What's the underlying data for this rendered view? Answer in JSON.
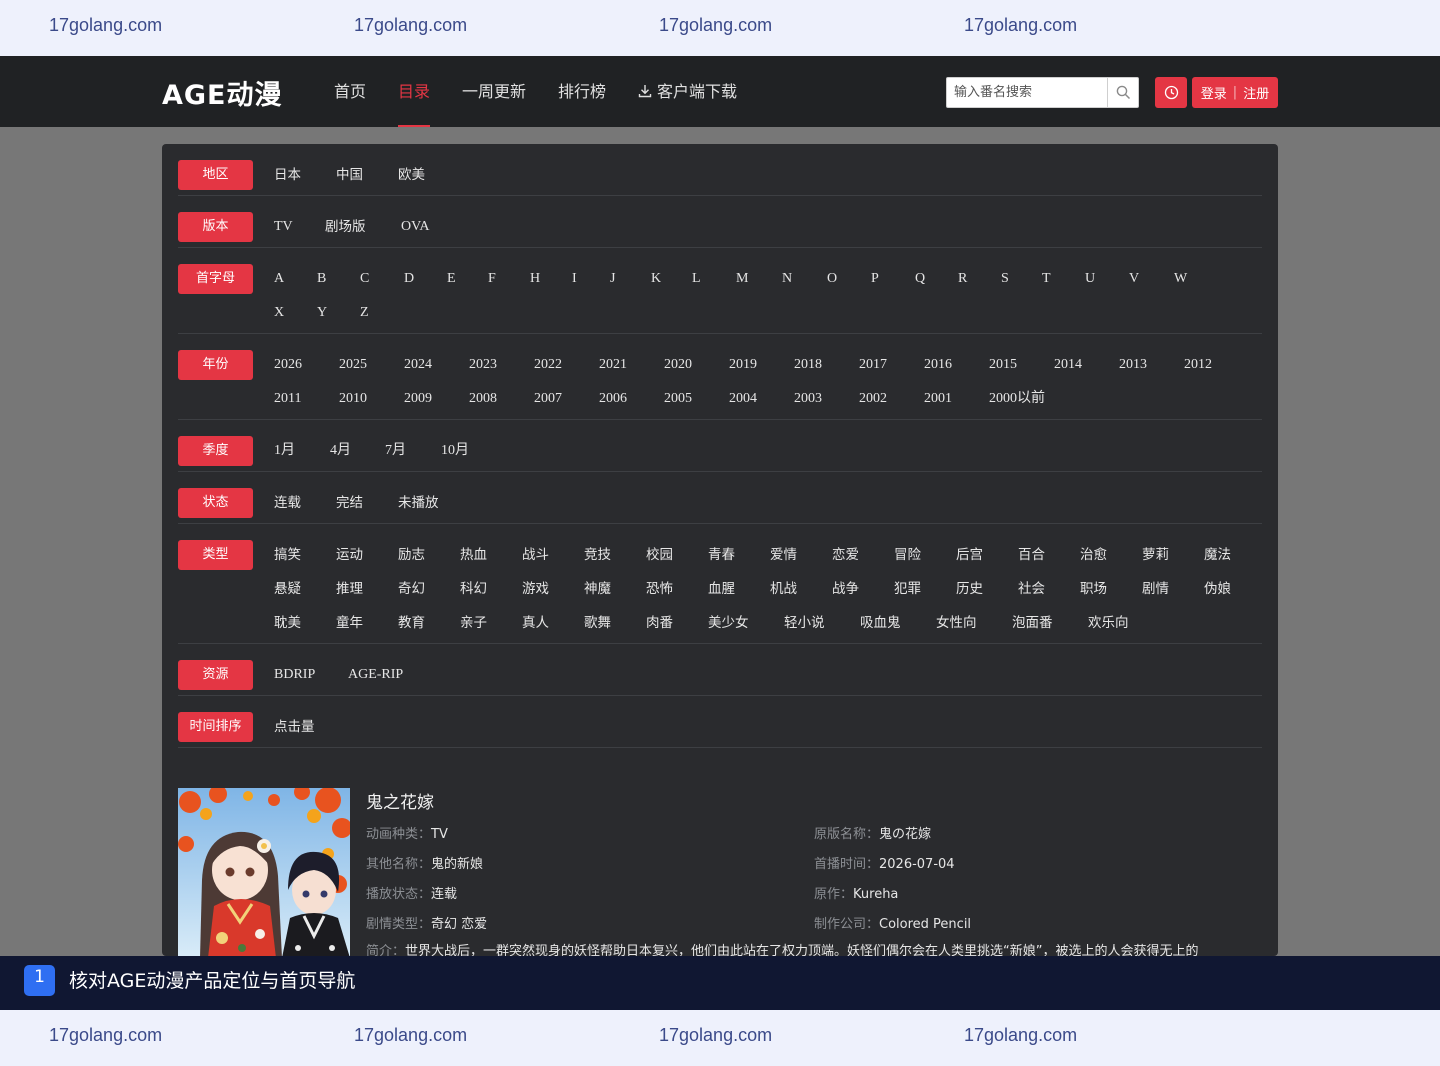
{
  "watermark": {
    "text": "17golang.com"
  },
  "nav": {
    "logo": "AGE动漫",
    "items": [
      "首页",
      "目录",
      "一周更新",
      "排行榜",
      "客户端下载"
    ],
    "active_index": 1,
    "search_placeholder": "输入番名搜索",
    "login_label": "登录",
    "register_label": "注册"
  },
  "filters": [
    {
      "label": "地区",
      "options": [
        "日本",
        "中国",
        "欧美"
      ]
    },
    {
      "label": "版本",
      "options": [
        "TV",
        "剧场版",
        "OVA"
      ]
    },
    {
      "label": "首字母",
      "options": [
        "A",
        "B",
        "C",
        "D",
        "E",
        "F",
        "H",
        "I",
        "J",
        "K",
        "L",
        "M",
        "N",
        "O",
        "P",
        "Q",
        "R",
        "S",
        "T",
        "U",
        "V",
        "W",
        "X",
        "Y",
        "Z"
      ]
    },
    {
      "label": "年份",
      "options": [
        "2026",
        "2025",
        "2024",
        "2023",
        "2022",
        "2021",
        "2020",
        "2019",
        "2018",
        "2017",
        "2016",
        "2015",
        "2014",
        "2013",
        "2012",
        "2011",
        "2010",
        "2009",
        "2008",
        "2007",
        "2006",
        "2005",
        "2004",
        "2003",
        "2002",
        "2001",
        "2000以前"
      ]
    },
    {
      "label": "季度",
      "options": [
        "1月",
        "4月",
        "7月",
        "10月"
      ]
    },
    {
      "label": "状态",
      "options": [
        "连载",
        "完结",
        "未播放"
      ]
    },
    {
      "label": "类型",
      "options": [
        "搞笑",
        "运动",
        "励志",
        "热血",
        "战斗",
        "竞技",
        "校园",
        "青春",
        "爱情",
        "恋爱",
        "冒险",
        "后宫",
        "百合",
        "治愈",
        "萝莉",
        "魔法",
        "悬疑",
        "推理",
        "奇幻",
        "科幻",
        "游戏",
        "神魔",
        "恐怖",
        "血腥",
        "机战",
        "战争",
        "犯罪",
        "历史",
        "社会",
        "职场",
        "剧情",
        "伪娘",
        "耽美",
        "童年",
        "教育",
        "亲子",
        "真人",
        "歌舞",
        "肉番",
        "美少女",
        "轻小说",
        "吸血鬼",
        "女性向",
        "泡面番",
        "欢乐向"
      ]
    },
    {
      "label": "资源",
      "options": [
        "BDRIP",
        "AGE-RIP"
      ]
    },
    {
      "label": "时间排序",
      "options": [
        "点击量"
      ]
    }
  ],
  "anime": {
    "title": "鬼之花嫁",
    "left_fields": [
      {
        "label": "动画种类：",
        "value": "TV"
      },
      {
        "label": "其他名称：",
        "value": "鬼的新娘"
      },
      {
        "label": "播放状态：",
        "value": "连载"
      },
      {
        "label": "剧情类型：",
        "value": "奇幻 恋爱"
      }
    ],
    "right_fields": [
      {
        "label": "原版名称：",
        "value": "鬼の花嫁"
      },
      {
        "label": "首播时间：",
        "value": "2026-07-04"
      },
      {
        "label": "原作：",
        "value": "Kureha"
      },
      {
        "label": "制作公司：",
        "value": "Colored Pencil"
      }
    ],
    "intro_label": "简介：",
    "intro": "世界大战后，一群突然现身的妖怪帮助日本复兴，他们由此站在了权力顶端。妖怪们偶尔会在人类里挑选“新娘”，被选上的人会获得无上的"
  },
  "task": {
    "number": "1",
    "text": "核对AGE动漫产品定位与首页导航"
  }
}
